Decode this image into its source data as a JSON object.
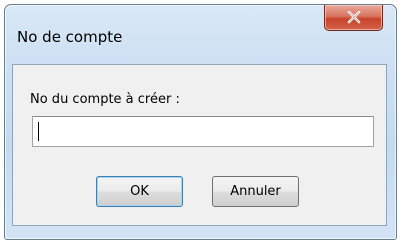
{
  "window": {
    "title": "No de compte",
    "close_icon": "close-icon"
  },
  "form": {
    "label": "No du compte à créer :",
    "account_value": "",
    "account_placeholder": ""
  },
  "buttons": {
    "ok_label": "OK",
    "cancel_label": "Annuler"
  },
  "colors": {
    "close_button": "#c7442b",
    "frame": "#cfe1f3",
    "client_background": "#f0f0f0",
    "default_button_border": "#3c7fb1"
  }
}
